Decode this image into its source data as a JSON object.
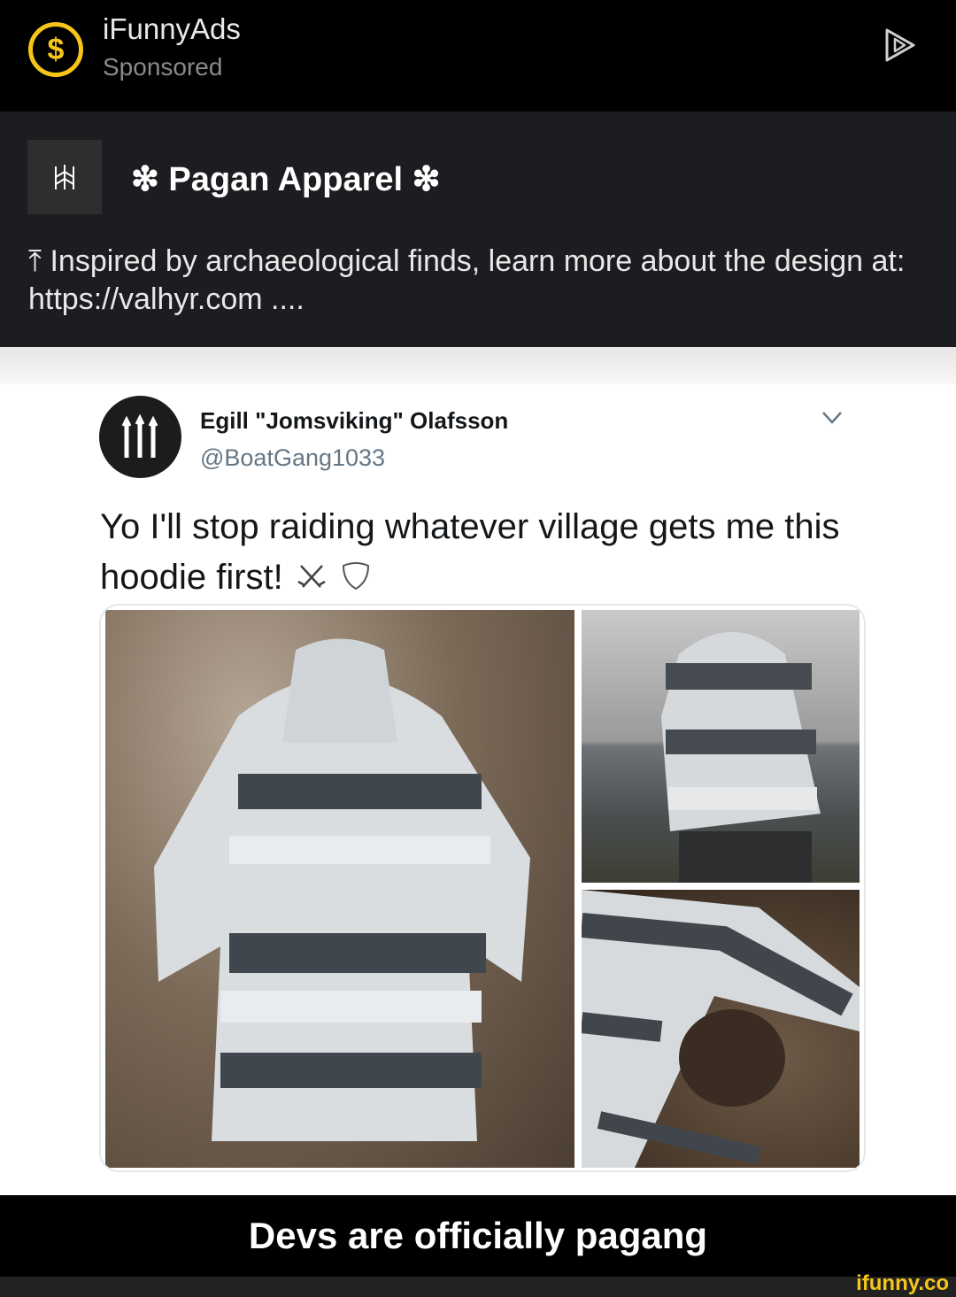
{
  "ad": {
    "brand_icon": "dollar-circle-icon",
    "title": "iFunnyAds",
    "subtitle": "Sponsored",
    "accent_color": "#f5c518"
  },
  "promo": {
    "name": "❇ Pagan Apparel ❇",
    "text": "⤒ Inspired by archaeological finds, learn more about the design at: https://valhyr.com ...."
  },
  "tweet": {
    "name": "Egill \"Jomsviking\" Olafsson",
    "handle": "@BoatGang1033",
    "text": "Yo I'll stop raiding whatever village gets me this hoodie first!",
    "emoji": [
      "crossed-swords-icon",
      "shield-icon"
    ]
  },
  "caption": "Devs are officially pagang",
  "watermark": "ifunny.co"
}
